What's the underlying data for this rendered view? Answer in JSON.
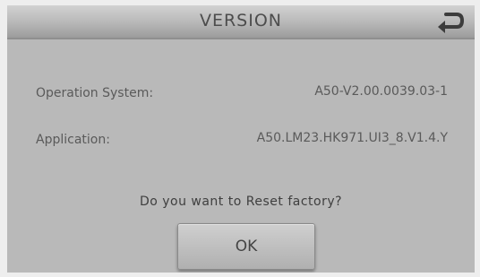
{
  "header": {
    "title": "VERSION",
    "back_icon": "return-arrow-icon"
  },
  "info": {
    "os_label": "Operation System:",
    "os_value": "A50-V2.00.0039.03-1",
    "app_label": "Application:",
    "app_value": "A50.LM23.HK971.UI3_8.V1.4.Y"
  },
  "dialog": {
    "question": "Do you want to Reset factory?",
    "ok_label": "OK"
  }
}
